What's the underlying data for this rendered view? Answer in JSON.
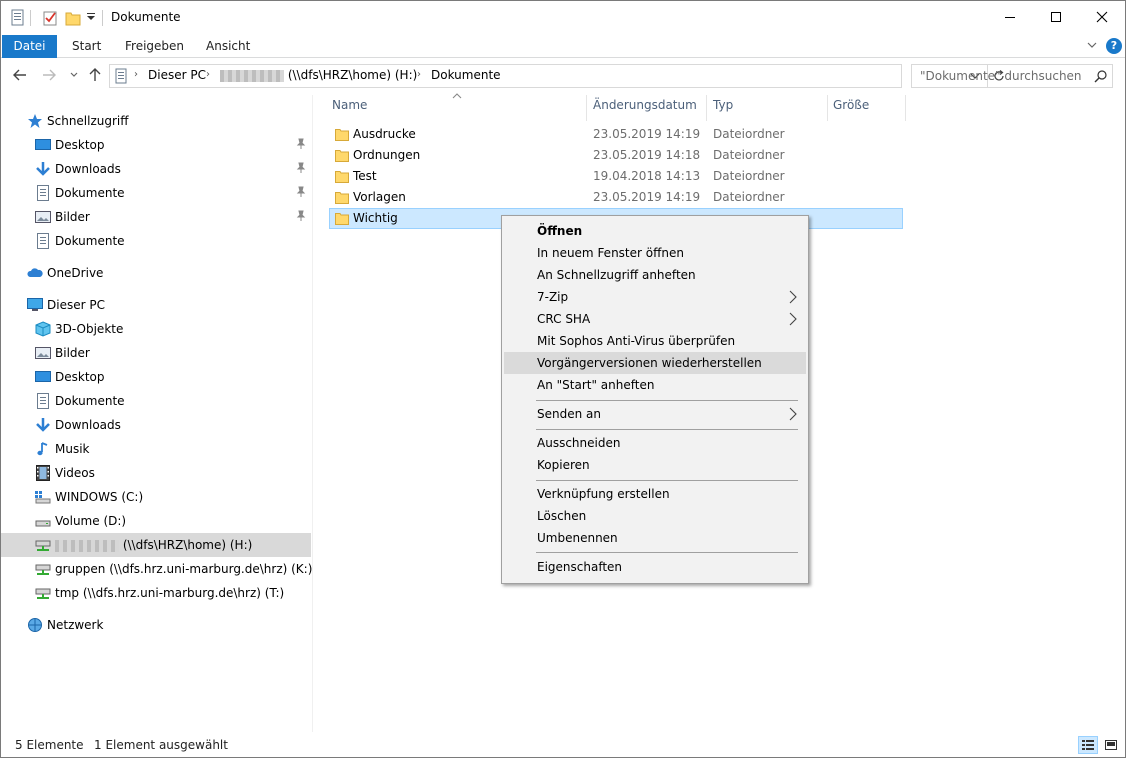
{
  "window": {
    "title": "Dokumente"
  },
  "ribbon": {
    "tabs": [
      "Datei",
      "Start",
      "Freigeben",
      "Ansicht"
    ],
    "help": "?"
  },
  "address": {
    "crumbs": [
      "Dieser PC",
      "(\\\\dfs\\HRZ\\home) (H:)",
      "Dokumente"
    ]
  },
  "search": {
    "placeholder": "\"Dokumente\" durchsuchen"
  },
  "sidebar": {
    "quick_access": "Schnellzugriff",
    "quick_items": [
      "Desktop",
      "Downloads",
      "Dokumente",
      "Bilder",
      "Dokumente"
    ],
    "onedrive": "OneDrive",
    "this_pc": "Dieser PC",
    "pc_items": [
      "3D-Objekte",
      "Bilder",
      "Desktop",
      "Dokumente",
      "Downloads",
      "Musik",
      "Videos",
      "WINDOWS (C:)",
      "Volume (D:)",
      "(\\\\dfs\\HRZ\\home) (H:)",
      "gruppen (\\\\dfs.hrz.uni-marburg.de\\hrz) (K:)",
      "tmp (\\\\dfs.hrz.uni-marburg.de\\hrz) (T:)"
    ],
    "network": "Netzwerk"
  },
  "columns": {
    "name": "Name",
    "date": "Änderungsdatum",
    "type": "Typ",
    "size": "Größe"
  },
  "files": [
    {
      "name": "Ausdrucke",
      "date": "23.05.2019 14:19",
      "type": "Dateiordner"
    },
    {
      "name": "Ordnungen",
      "date": "23.05.2019 14:18",
      "type": "Dateiordner"
    },
    {
      "name": "Test",
      "date": "19.04.2018 14:13",
      "type": "Dateiordner"
    },
    {
      "name": "Vorlagen",
      "date": "23.05.2019 14:19",
      "type": "Dateiordner"
    },
    {
      "name": "Wichtig",
      "date": "",
      "type": ""
    }
  ],
  "context_menu": {
    "items": [
      "Öffnen",
      "In neuem Fenster öffnen",
      "An Schnellzugriff anheften",
      "7-Zip",
      "CRC SHA",
      "Mit Sophos Anti-Virus überprüfen",
      "Vorgängerversionen wiederherstellen",
      "An \"Start\" anheften",
      "Senden an",
      "Ausschneiden",
      "Kopieren",
      "Verknüpfung erstellen",
      "Löschen",
      "Umbenennen",
      "Eigenschaften"
    ]
  },
  "status": {
    "count": "5 Elemente",
    "selected": "1 Element ausgewählt"
  },
  "colors": {
    "accent": "#1979ca",
    "selection": "#cce8ff",
    "folder": "#ffd86b"
  }
}
